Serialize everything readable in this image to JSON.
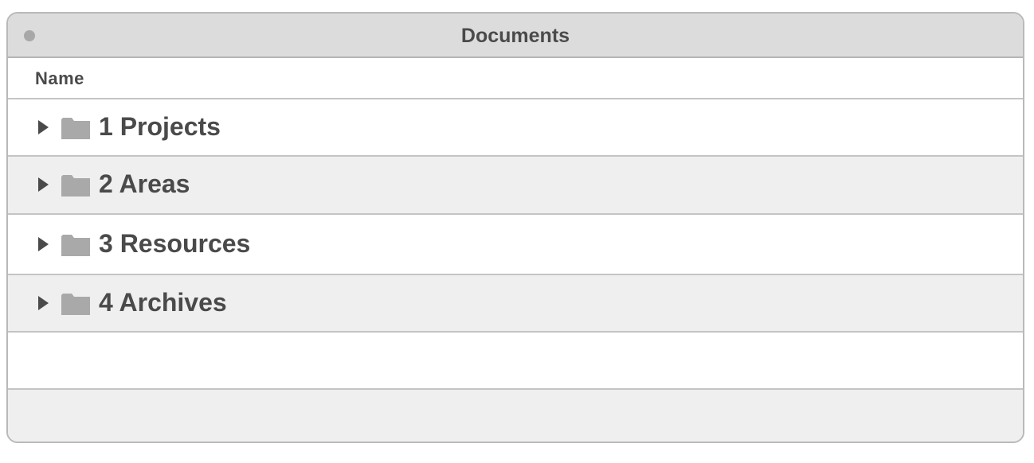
{
  "window": {
    "title": "Documents"
  },
  "list": {
    "column_name": "Name",
    "items": [
      {
        "label": "1 Projects",
        "icon": "folder-icon"
      },
      {
        "label": "2 Areas",
        "icon": "folder-icon"
      },
      {
        "label": "3 Resources",
        "icon": "folder-icon"
      },
      {
        "label": "4 Archives",
        "icon": "folder-icon"
      }
    ]
  },
  "colors": {
    "titlebar": "#dcdcdc",
    "text": "#4a4a4a",
    "folder": "#a9a9a9",
    "alt_row": "#efefef"
  }
}
